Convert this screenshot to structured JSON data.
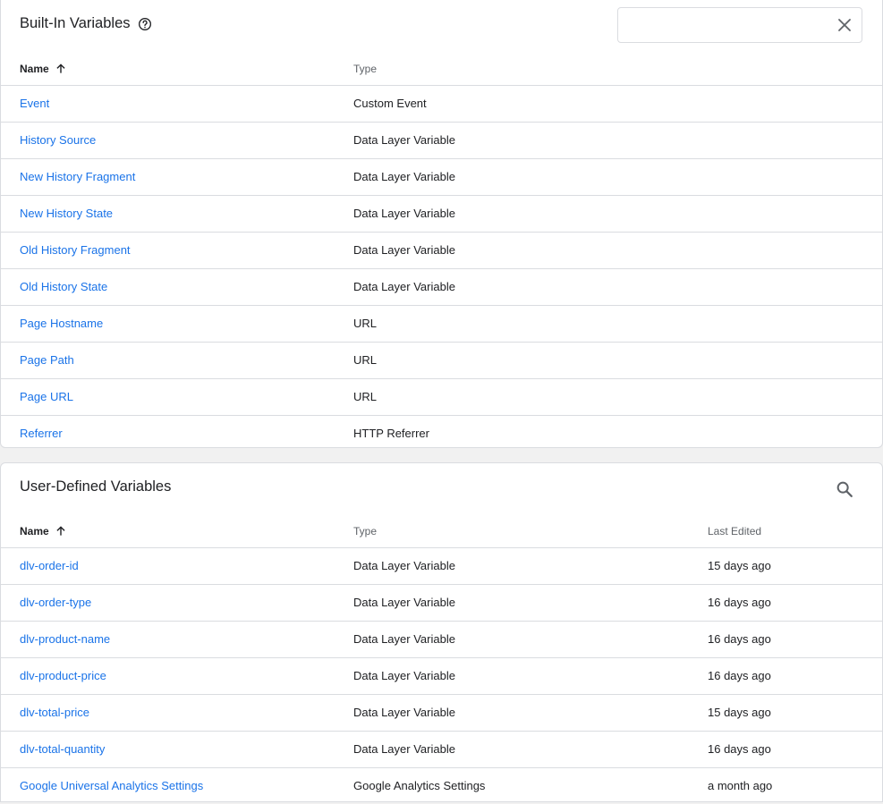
{
  "builtin": {
    "title": "Built-In Variables",
    "search_value": "",
    "columns": {
      "name": "Name",
      "type": "Type"
    },
    "rows": [
      {
        "name": "Event",
        "type": "Custom Event"
      },
      {
        "name": "History Source",
        "type": "Data Layer Variable"
      },
      {
        "name": "New History Fragment",
        "type": "Data Layer Variable"
      },
      {
        "name": "New History State",
        "type": "Data Layer Variable"
      },
      {
        "name": "Old History Fragment",
        "type": "Data Layer Variable"
      },
      {
        "name": "Old History State",
        "type": "Data Layer Variable"
      },
      {
        "name": "Page Hostname",
        "type": "URL"
      },
      {
        "name": "Page Path",
        "type": "URL"
      },
      {
        "name": "Page URL",
        "type": "URL"
      },
      {
        "name": "Referrer",
        "type": "HTTP Referrer"
      }
    ]
  },
  "userdefined": {
    "title": "User-Defined Variables",
    "columns": {
      "name": "Name",
      "type": "Type",
      "edited": "Last Edited"
    },
    "rows": [
      {
        "name": "dlv-order-id",
        "type": "Data Layer Variable",
        "edited": "15 days ago"
      },
      {
        "name": "dlv-order-type",
        "type": "Data Layer Variable",
        "edited": "16 days ago"
      },
      {
        "name": "dlv-product-name",
        "type": "Data Layer Variable",
        "edited": "16 days ago"
      },
      {
        "name": "dlv-product-price",
        "type": "Data Layer Variable",
        "edited": "16 days ago"
      },
      {
        "name": "dlv-total-price",
        "type": "Data Layer Variable",
        "edited": "15 days ago"
      },
      {
        "name": "dlv-total-quantity",
        "type": "Data Layer Variable",
        "edited": "16 days ago"
      },
      {
        "name": "Google Universal Analytics Settings",
        "type": "Google Analytics Settings",
        "edited": "a month ago"
      }
    ]
  },
  "icons": {
    "help": "help-circle-icon",
    "close": "close-icon",
    "search": "search-icon",
    "sort": "arrow-up-icon"
  },
  "colors": {
    "link": "#1a73e8",
    "border": "#dadce0",
    "background": "#f1f1f1"
  }
}
